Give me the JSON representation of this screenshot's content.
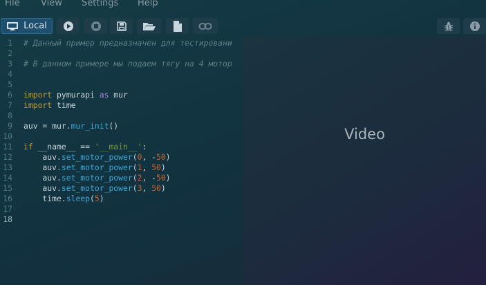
{
  "menu": {
    "items": [
      {
        "label": "File"
      },
      {
        "label": "View"
      },
      {
        "label": "Settings"
      },
      {
        "label": "Help"
      }
    ]
  },
  "toolbar": {
    "local_label": "Local",
    "buttons": [
      {
        "icon": "monitor-icon"
      },
      {
        "icon": "play-icon"
      },
      {
        "icon": "stop-icon"
      },
      {
        "icon": "save-icon"
      },
      {
        "icon": "open-folder-icon"
      },
      {
        "icon": "new-file-icon"
      },
      {
        "icon": "link-icon"
      },
      {
        "icon": "bug-icon"
      },
      {
        "icon": "info-icon"
      }
    ]
  },
  "editor": {
    "active_line": 18,
    "lines": [
      {
        "n": "1",
        "tokens": [
          {
            "t": "# Данный пример предназначен для тестировани",
            "c": "comment"
          }
        ]
      },
      {
        "n": "2",
        "tokens": []
      },
      {
        "n": "3",
        "tokens": [
          {
            "t": "# В данном примере мы подаем тягу на 4 мотор",
            "c": "comment"
          }
        ]
      },
      {
        "n": "4",
        "tokens": []
      },
      {
        "n": "5",
        "tokens": []
      },
      {
        "n": "6",
        "tokens": [
          {
            "t": "import",
            "c": "kw"
          },
          {
            "t": " pymurapi ",
            "c": "plain"
          },
          {
            "t": "as",
            "c": "kw2"
          },
          {
            "t": " mur",
            "c": "plain"
          }
        ]
      },
      {
        "n": "7",
        "tokens": [
          {
            "t": "import",
            "c": "kw"
          },
          {
            "t": " time",
            "c": "plain"
          }
        ]
      },
      {
        "n": "8",
        "tokens": []
      },
      {
        "n": "9",
        "tokens": [
          {
            "t": "auv = mur.",
            "c": "plain"
          },
          {
            "t": "mur_init",
            "c": "fn"
          },
          {
            "t": "()",
            "c": "plain"
          }
        ]
      },
      {
        "n": "10",
        "tokens": []
      },
      {
        "n": "11",
        "tokens": [
          {
            "t": "if",
            "c": "kw"
          },
          {
            "t": " __name__ == ",
            "c": "plain"
          },
          {
            "t": "'__main__'",
            "c": "str"
          },
          {
            "t": ":",
            "c": "plain"
          }
        ]
      },
      {
        "n": "12",
        "tokens": [
          {
            "t": "    auv.",
            "c": "plain"
          },
          {
            "t": "set_motor_power",
            "c": "fn"
          },
          {
            "t": "(",
            "c": "plain"
          },
          {
            "t": "0",
            "c": "num"
          },
          {
            "t": ", -",
            "c": "plain"
          },
          {
            "t": "50",
            "c": "num"
          },
          {
            "t": ")",
            "c": "plain"
          }
        ]
      },
      {
        "n": "13",
        "tokens": [
          {
            "t": "    auv.",
            "c": "plain"
          },
          {
            "t": "set_motor_power",
            "c": "fn"
          },
          {
            "t": "(",
            "c": "plain"
          },
          {
            "t": "1",
            "c": "num"
          },
          {
            "t": ", ",
            "c": "plain"
          },
          {
            "t": "50",
            "c": "num"
          },
          {
            "t": ")",
            "c": "plain"
          }
        ]
      },
      {
        "n": "14",
        "tokens": [
          {
            "t": "    auv.",
            "c": "plain"
          },
          {
            "t": "set_motor_power",
            "c": "fn"
          },
          {
            "t": "(",
            "c": "plain"
          },
          {
            "t": "2",
            "c": "num"
          },
          {
            "t": ", -",
            "c": "plain"
          },
          {
            "t": "50",
            "c": "num"
          },
          {
            "t": ")",
            "c": "plain"
          }
        ]
      },
      {
        "n": "15",
        "tokens": [
          {
            "t": "    auv.",
            "c": "plain"
          },
          {
            "t": "set_motor_power",
            "c": "fn"
          },
          {
            "t": "(",
            "c": "plain"
          },
          {
            "t": "3",
            "c": "num"
          },
          {
            "t": ", ",
            "c": "plain"
          },
          {
            "t": "50",
            "c": "num"
          },
          {
            "t": ")",
            "c": "plain"
          }
        ]
      },
      {
        "n": "16",
        "tokens": [
          {
            "t": "    time.",
            "c": "plain"
          },
          {
            "t": "sleep",
            "c": "fn"
          },
          {
            "t": "(",
            "c": "plain"
          },
          {
            "t": "5",
            "c": "num"
          },
          {
            "t": ")",
            "c": "plain"
          }
        ]
      },
      {
        "n": "17",
        "tokens": []
      },
      {
        "n": "18",
        "tokens": []
      }
    ]
  },
  "video": {
    "label": "Video"
  },
  "colors": {
    "background": "#143c46",
    "comment": "#5f7f89",
    "keyword": "#c79a2a",
    "keyword_as": "#a884d4",
    "function": "#3ea8d8",
    "number": "#c8662e",
    "string": "#7e9a3c",
    "local_button": "#1f4f6e"
  }
}
